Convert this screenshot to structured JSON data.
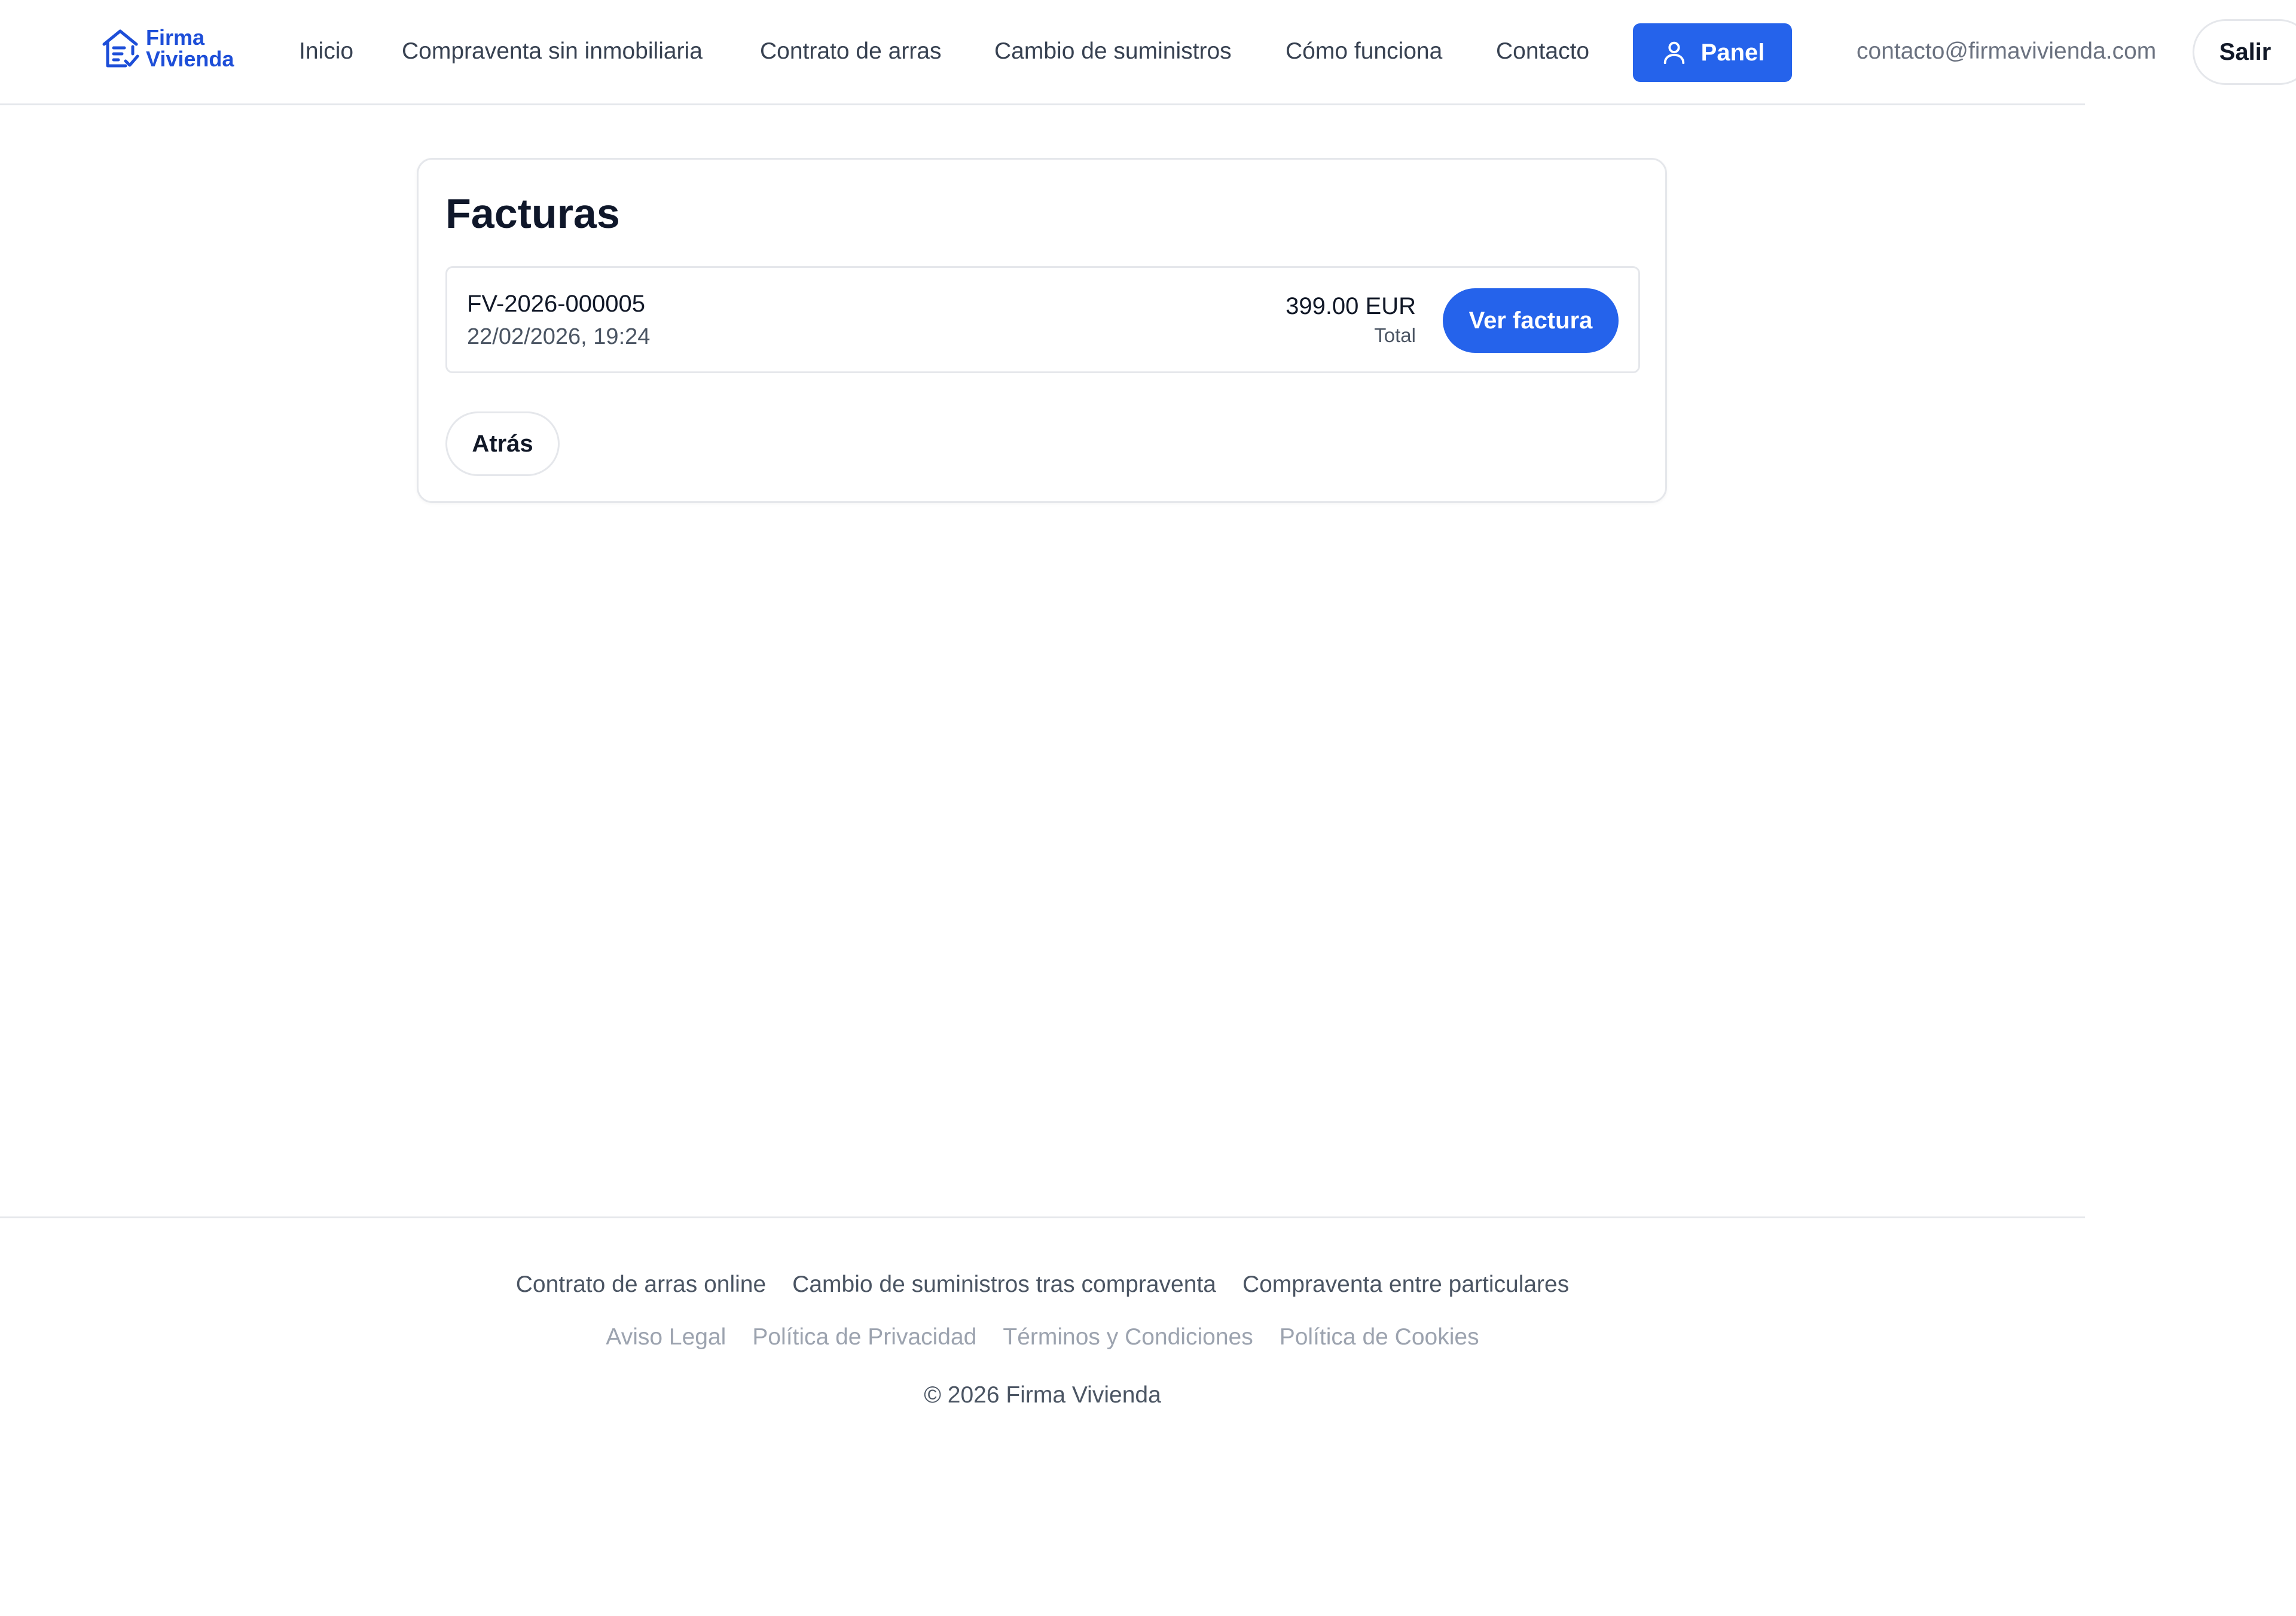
{
  "brand": {
    "name_line1": "Firma",
    "name_line2": "Vivienda",
    "accent": "#2563eb",
    "logo_icon": "house-check-icon"
  },
  "nav": {
    "items": [
      {
        "label": "Inicio"
      },
      {
        "label": "Compraventa sin inmobiliaria"
      },
      {
        "label": "Contrato de arras"
      },
      {
        "label": "Cambio de suministros"
      },
      {
        "label": "Cómo funciona"
      },
      {
        "label": "Contacto"
      }
    ],
    "panel_label": "Panel",
    "panel_icon": "user-icon",
    "user_email": "contacto@firmavivienda.com",
    "logout_label": "Salir"
  },
  "invoices": {
    "title": "Facturas",
    "items": [
      {
        "number": "FV-2026-000005",
        "date": "22/02/2026, 19:24",
        "amount": "399.00 EUR",
        "amount_label": "Total",
        "action_label": "Ver factura"
      }
    ],
    "back_label": "Atrás"
  },
  "footer": {
    "primary_links": [
      {
        "label": "Contrato de arras online"
      },
      {
        "label": "Cambio de suministros tras compraventa"
      },
      {
        "label": "Compraventa entre particulares"
      }
    ],
    "legal_links": [
      {
        "label": "Aviso Legal"
      },
      {
        "label": "Política de Privacidad"
      },
      {
        "label": "Términos y Condiciones"
      },
      {
        "label": "Política de Cookies"
      }
    ],
    "copyright": "© 2026 Firma Vivienda"
  }
}
